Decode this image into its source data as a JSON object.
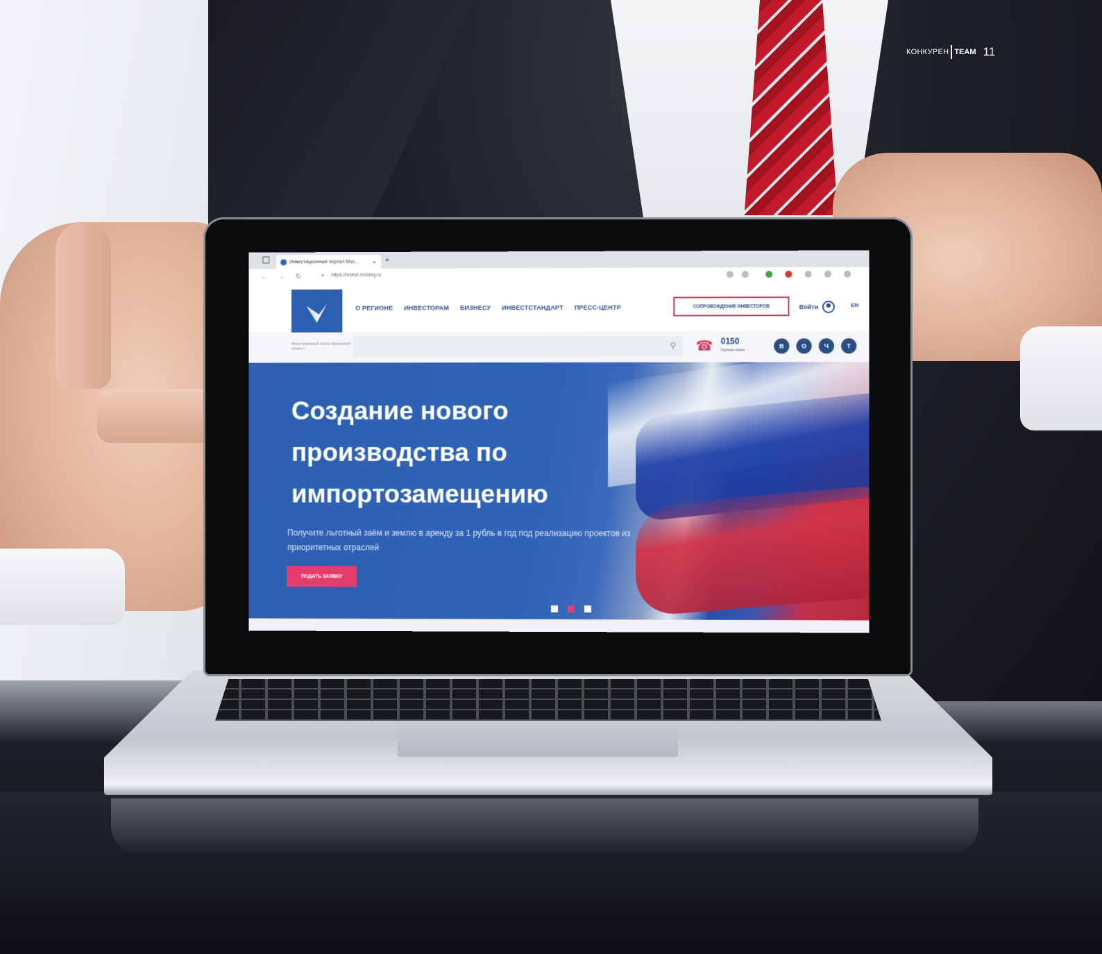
{
  "magazine": {
    "brand_left": "КОНКУРЕН",
    "brand_right": "TEAM",
    "page_number": "11"
  },
  "browser": {
    "tab_title": "Инвестиционный портал Мос...",
    "tab_close": "×",
    "new_tab": "+",
    "url": "https://invest.mosreg.ru"
  },
  "site": {
    "nav": [
      "О РЕГИОНЕ",
      "ИНВЕСТОРАМ",
      "БИЗНЕСУ",
      "ИНВЕСТСТАНДАРТ",
      "ПРЕСС-ЦЕНТР"
    ],
    "cta_outline": "СОПРОВОЖДЕНИЕ ИНВЕСТОРОВ",
    "login": "Войти",
    "lang": "EN",
    "sub_note": "Инвестиционный портал Московской области",
    "phone_number": "0150",
    "phone_label": "Горячая линия",
    "social": [
      "В",
      "О",
      "Ч",
      "Т"
    ]
  },
  "hero": {
    "title_lines": [
      "Создание нового",
      "производства по",
      "импортозамещению"
    ],
    "text": "Получите льготный заём и землю в аренду за 1 рубль в год под реализацию проектов из приоритетных отраслей",
    "button": "ПОДАТЬ ЗАЯВКУ",
    "slides_total": 3,
    "active_slide": 2
  },
  "colors": {
    "brand_blue": "#2d5fb0",
    "accent_pink": "#e33e6b"
  },
  "icons": [
    "window-icon",
    "favicon-icon",
    "back-icon",
    "forward-icon",
    "reload-icon",
    "lock-icon",
    "search-icon",
    "phone-icon",
    "user-icon",
    "logo-icon"
  ]
}
